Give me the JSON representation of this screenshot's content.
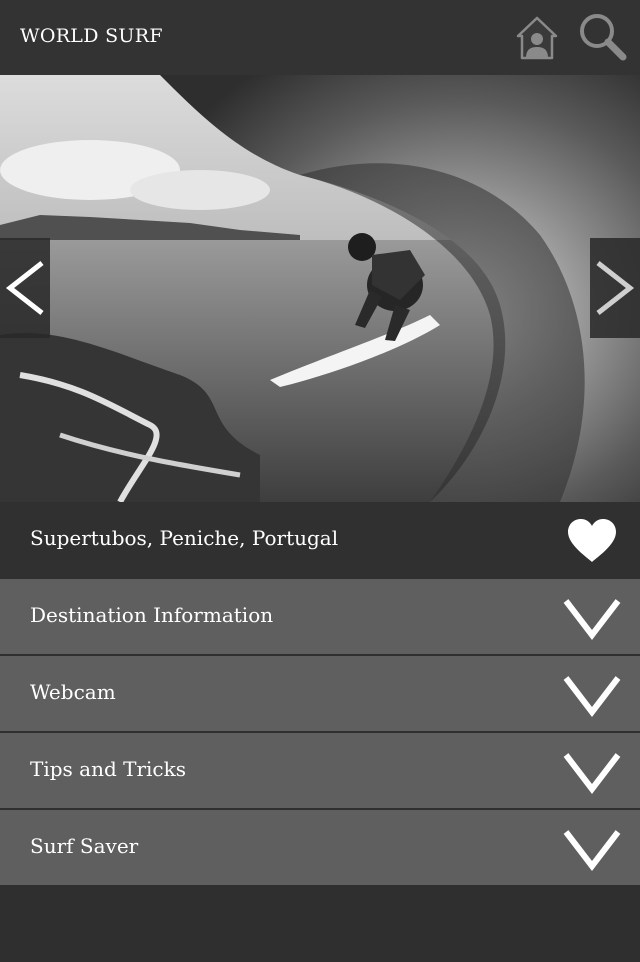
{
  "header": {
    "title": "WORLD SURF",
    "home_icon": "home-user-icon",
    "search_icon": "search-icon"
  },
  "hero": {
    "image": "surfer riding inside a barrel wave (photo)",
    "prev_icon": "chevron-left-icon",
    "next_icon": "chevron-right-icon"
  },
  "location": {
    "name": "Supertubos, Peniche, Portugal",
    "favorite_icon": "heart-icon"
  },
  "sections": [
    {
      "label": "Destination Information",
      "icon": "chevron-down-icon"
    },
    {
      "label": "Webcam",
      "icon": "chevron-down-icon"
    },
    {
      "label": "Tips and Tricks",
      "icon": "chevron-down-icon"
    },
    {
      "label": "Surf Saver",
      "icon": "chevron-down-icon"
    }
  ],
  "colors": {
    "header_bg": "#333333",
    "title_bar_bg": "#303030",
    "section_bg": "#5f5f5f",
    "text": "#ffffff"
  }
}
